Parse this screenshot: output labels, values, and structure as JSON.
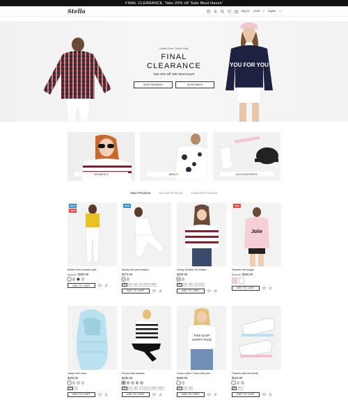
{
  "topbar": {
    "text": "FINAL CLEARANCE: Take 20% off 'Sale Must-Haves'"
  },
  "header": {
    "logo": "Stella",
    "bag": "Bag (0)",
    "currency": "USD$",
    "language": "English"
  },
  "hero": {
    "kicker": "Limited Time. Online Only!",
    "title_line1": "FINAL",
    "title_line2": "CLEARANCE",
    "subtitle": "Take 20% Off 'Sale Must-Haves'",
    "btn_women": "SHOP WOMEN'S",
    "btn_men": "SHOP MEN'S",
    "shirt_print": "YOU FOR YOU"
  },
  "categories": [
    {
      "label": "WOMEN'S"
    },
    {
      "label": "MEN'S"
    },
    {
      "label": "ACCESSORIES"
    }
  ],
  "tabs": [
    "New Products",
    "Special Products",
    "Featured Products"
  ],
  "products": [
    {
      "name": "Belted chino trousers pale",
      "old_price": "$400.00",
      "price": "$320.00",
      "badges": [
        "NEW",
        "-20%"
      ],
      "swatches": [
        "#ffffff",
        "#d8c3a5",
        "#222222",
        "#d0d0d0"
      ],
      "add": "ADD TO CART"
    },
    {
      "name": "Skinny mid-rise trousers",
      "old_price": "",
      "price": "$171.00",
      "badges": [
        "NEW"
      ],
      "swatches": [
        "#f2c9cf",
        "#cfcfcf"
      ],
      "sizes": [
        "XS",
        "S",
        "M",
        "L",
        "XL",
        "XXL"
      ],
      "add": "ADD TO CART"
    },
    {
      "name": "Jersey Graphic Tee Dotted",
      "old_price": "",
      "price": "$330.00",
      "badges": [],
      "swatches": [
        "#e8b4c0",
        "#cfcfcf"
      ],
      "sizes": [
        "XS",
        "S",
        "M",
        "L",
        "XL"
      ],
      "add": "ADD TO CART"
    },
    {
      "name": "Sweater with slogan",
      "old_price": "$400.00",
      "price": "$320.00",
      "badges": [
        "-20%"
      ],
      "thumbs": 2,
      "add": "ADD TO CART"
    },
    {
      "name": "Jacket with hood",
      "old_price": "",
      "price": "$230.00",
      "badges": [],
      "swatches": [
        "#ffffff",
        "#b9e2ee",
        "#f2c0d0",
        "#d7d7d7"
      ],
      "sizes": [
        "XS",
        "S"
      ],
      "add": "ADD TO CART"
    },
    {
      "name": "Round neck sweater",
      "old_price": "",
      "price": "$330.00",
      "badges": [],
      "swatches": [
        "#8b6a4f",
        "#c0a060",
        "#e2a5c0",
        "#9c7bb0",
        "#8fb0d8"
      ],
      "sizes": [
        "XS",
        "S",
        "M",
        "L",
        "XL",
        "XXL",
        "3XL"
      ],
      "add": "ADD TO CART"
    },
    {
      "name": "Grown cotton T-shirt with print",
      "old_price": "",
      "price": "$350.00",
      "badges": [],
      "swatches": [
        "#ffffff",
        "#f2c9cf"
      ],
      "sizes": [
        "XS",
        "S",
        "M"
      ],
      "add": "ADD TO CART"
    },
    {
      "name": "Trainers with heel detail",
      "old_price": "",
      "price": "$410.00",
      "badges": [],
      "swatches": [
        "#ffffff",
        "#b9e2ee",
        "#f2c0d0"
      ],
      "sizes": [
        "36",
        "37"
      ],
      "add": "ADD TO CART"
    }
  ],
  "colors": {
    "accent": "#111111",
    "new_badge": "#2f8fd8",
    "sale_badge": "#e74c3c"
  }
}
